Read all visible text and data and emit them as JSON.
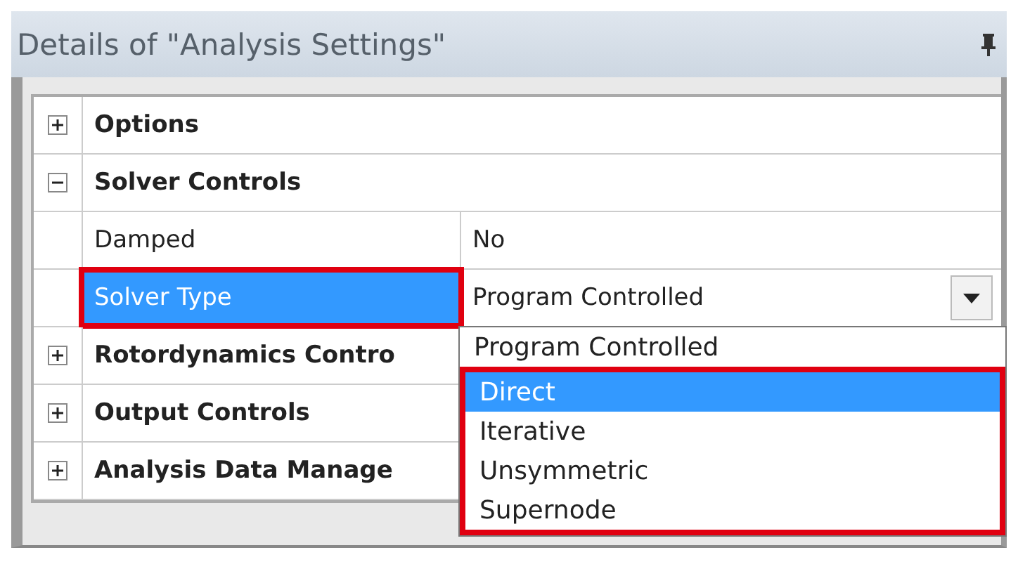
{
  "panel": {
    "title": "Details of \"Analysis Settings\""
  },
  "rows": [
    {
      "kind": "group",
      "label": "Options",
      "expanded": false
    },
    {
      "kind": "group",
      "label": "Solver Controls",
      "expanded": true
    },
    {
      "kind": "property",
      "label": "Damped",
      "value": "No",
      "selected": false,
      "highlighted": false
    },
    {
      "kind": "property",
      "label": "Solver Type",
      "value": "Program Controlled",
      "selected": true,
      "highlighted": true
    },
    {
      "kind": "group",
      "label": "Rotordynamics Contro",
      "expanded": false
    },
    {
      "kind": "group",
      "label": "Output Controls",
      "expanded": false
    },
    {
      "kind": "group",
      "label": "Analysis Data Manage",
      "expanded": false
    }
  ],
  "dropdown": {
    "options": [
      {
        "label": "Program Controlled",
        "selected": false,
        "highlighted": false
      },
      {
        "label": "Direct",
        "selected": true,
        "highlighted": true
      },
      {
        "label": "Iterative",
        "selected": false,
        "highlighted": true
      },
      {
        "label": "Unsymmetric",
        "selected": false,
        "highlighted": true
      },
      {
        "label": "Supernode",
        "selected": false,
        "highlighted": true
      }
    ]
  }
}
